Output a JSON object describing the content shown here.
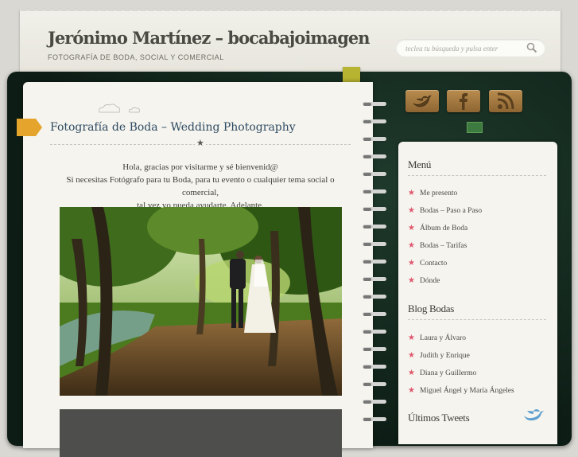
{
  "header": {
    "site_title": "Jerónimo Martínez – bocabajoimagen",
    "site_description": "FOTOGRAFÍA DE BODA, SOCIAL Y COMERCIAL",
    "search_placeholder": "teclea tu búsqueda y pulsa enter"
  },
  "post": {
    "title": "Fotografía de Boda – Wedding Photography",
    "line1": "Hola, gracias por visitarme y sé bienvenid@",
    "line2": "Si necesitas Fotógrafo para tu Boda, para tu evento o cualquier tema social o comercial,",
    "line3": "tal vez yo pueda ayudarte. Adelante."
  },
  "social": [
    "twitter-icon",
    "facebook-icon",
    "rss-icon"
  ],
  "sidebar": {
    "menu_title": "Menú",
    "menu_items": [
      "Me presento",
      "Bodas – Paso a Paso",
      "Álbum de Boda",
      "Bodas – Tarifas",
      "Contacto",
      "Dónde"
    ],
    "blog_title": "Blog Bodas",
    "blog_items": [
      "Laura y Álvaro",
      "Judith y Enrique",
      "Diana y Guillermo",
      "Miguel Ángel y María Ángeles"
    ],
    "tweets_title": "Últimos Tweets"
  },
  "colors": {
    "accent_star": "#e0566d",
    "title_blue": "#2e4a62",
    "notebook": "#0d1d15",
    "tab_orange": "#e5a52c"
  }
}
